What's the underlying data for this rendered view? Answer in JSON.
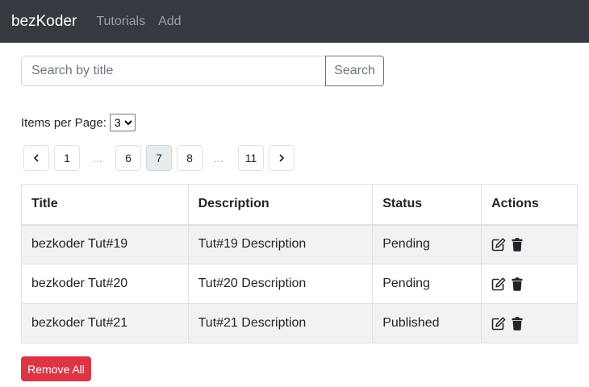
{
  "navbar": {
    "brand": "bezKoder",
    "links": [
      "Tutorials",
      "Add"
    ]
  },
  "search": {
    "placeholder": "Search by title",
    "value": "",
    "button_label": "Search"
  },
  "per_page": {
    "label": "Items per Page:",
    "selected": "3"
  },
  "pagination": {
    "prev_icon": "chevron-left-icon",
    "next_icon": "chevron-right-icon",
    "pages": [
      "1",
      "6",
      "7",
      "8",
      "11"
    ],
    "ellipsis": "…",
    "current": "7"
  },
  "table": {
    "headers": [
      "Title",
      "Description",
      "Status",
      "Actions"
    ],
    "rows": [
      {
        "title": "bezkoder Tut#19",
        "description": "Tut#19 Description",
        "status": "Pending"
      },
      {
        "title": "bezkoder Tut#20",
        "description": "Tut#20 Description",
        "status": "Pending"
      },
      {
        "title": "bezkoder Tut#21",
        "description": "Tut#21 Description",
        "status": "Published"
      }
    ],
    "action_icons": [
      "edit-icon",
      "trash-icon"
    ]
  },
  "remove_all_label": "Remove All",
  "colors": {
    "navbar": "#343a40",
    "danger": "#dc3545",
    "secondary": "#6c757d",
    "active_page": "#e9ecef"
  }
}
